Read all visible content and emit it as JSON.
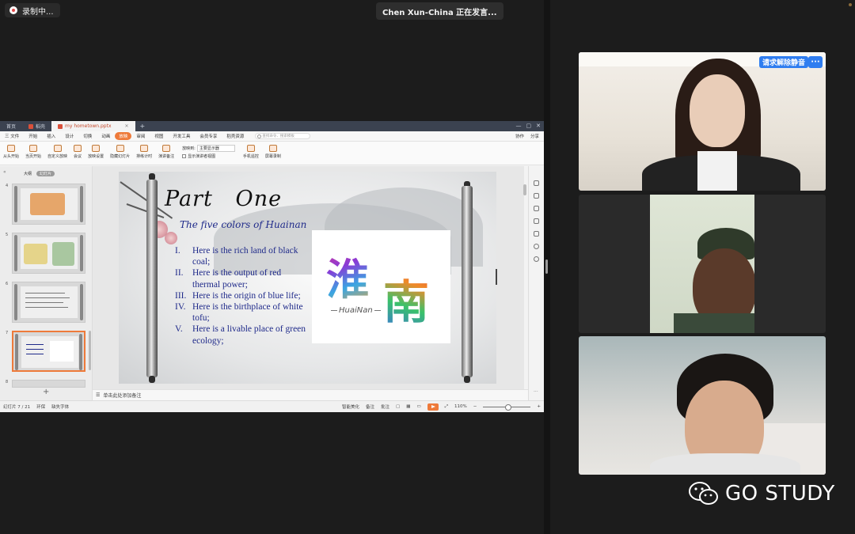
{
  "recording": {
    "label": "录制中..."
  },
  "speaker": {
    "label": "Chen Xun-China 正在发言..."
  },
  "wps": {
    "tabs": [
      {
        "label": "首页"
      },
      {
        "label": "稻壳"
      },
      {
        "label": "my hometown.pptx"
      }
    ],
    "menu": [
      {
        "label": "三 文件"
      },
      {
        "label": "开始"
      },
      {
        "label": "插入"
      },
      {
        "label": "设计"
      },
      {
        "label": "切换"
      },
      {
        "label": "动画"
      },
      {
        "label": "放映"
      },
      {
        "label": "审阅"
      },
      {
        "label": "视图"
      },
      {
        "label": "开发工具"
      },
      {
        "label": "会员专享"
      },
      {
        "label": "稻壳资源"
      }
    ],
    "search_placeholder": "查找命令、搜索模板",
    "menu_right": [
      "协作",
      "分享"
    ],
    "ribbon": [
      {
        "label": "从头开始"
      },
      {
        "label": "当页开始"
      },
      {
        "label": "自定义放映"
      },
      {
        "label": "会议"
      },
      {
        "label": "放映设置"
      },
      {
        "label": "隐藏幻灯片"
      },
      {
        "label": "排练计时"
      },
      {
        "label": "演讲备注"
      }
    ],
    "ribbon_select_label": "放映到:",
    "ribbon_select_value": "主要显示器",
    "ribbon_checkbox": "显示演讲者视图",
    "ribbon_extra": [
      {
        "label": "手机遥控"
      },
      {
        "label": "屏幕录制"
      }
    ],
    "thumb_tabs": [
      "大纲",
      "幻灯片"
    ],
    "thumb_numbers": [
      "4",
      "5",
      "6",
      "7",
      "8"
    ],
    "slide": {
      "title": "Part   One",
      "subtitle": "The five colors of Huainan",
      "points": [
        {
          "num": "I.",
          "text": "Here is the rich land of black coal;"
        },
        {
          "num": "II.",
          "text": "Here is the output of red thermal power;"
        },
        {
          "num": "III.",
          "text": "Here is the origin of blue life;"
        },
        {
          "num": "IV.",
          "text": "Here is the birthplace of white tofu;"
        },
        {
          "num": "V.",
          "text": "Here is a livable place of green ecology;"
        }
      ],
      "logo_char1": "淮",
      "logo_char2": "南",
      "logo_en": "HuaiNan"
    },
    "notes_placeholder": "单击此处添加备注",
    "status": {
      "slide_count": "幻灯片 7 / 21",
      "theme": "环保",
      "font_missing": "缺失字体",
      "smart_beautify": "智能美化",
      "notes": "备注",
      "comments": "批注",
      "zoom": "110%"
    }
  },
  "video": {
    "unmute_label": "请求解除静音",
    "more_label": "···"
  },
  "watermark": {
    "text": "GO STUDY"
  }
}
